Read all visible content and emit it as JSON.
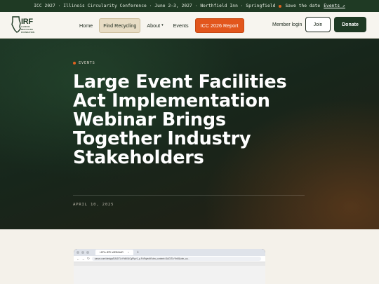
{
  "topbar": {
    "conference": "ICC 2027 · Illinois Circularity Conference · June 2–3, 2027 · Northfield Inn · Springfield",
    "save_the_date": "Save the date",
    "events_link": "Events ↗"
  },
  "nav": {
    "logo_big": "IRF",
    "logo_small_1": "ILLINOIS",
    "logo_small_2": "RECYCLING",
    "logo_small_3": "FOUNDATION",
    "items": [
      {
        "label": "Home"
      },
      {
        "label": "Find Recycling"
      },
      {
        "label": "About"
      },
      {
        "label": "Events"
      },
      {
        "label": "ICC 2026 Report"
      }
    ],
    "member_login": "Member login",
    "join": "Join",
    "donate": "Donate"
  },
  "hero": {
    "eyebrow": "EVENTS",
    "title": "Large Event Facilities Act Implementation Webinar Brings Together Industry Stakeholders",
    "date": "APRIL 10, 2025"
  },
  "screenshot": {
    "tab_label": "LEFA-IEPI-WEBINAR",
    "url": "canva.com/design/DAGiTLrYhM/UiCgPlpv1_p-FoRq/edit?utm_content=DAGiTLrYhM&utm_ca..."
  },
  "colors": {
    "brand_green": "#1f3a24",
    "accent_orange": "#e2561c",
    "cream": "#f7f5ef"
  }
}
